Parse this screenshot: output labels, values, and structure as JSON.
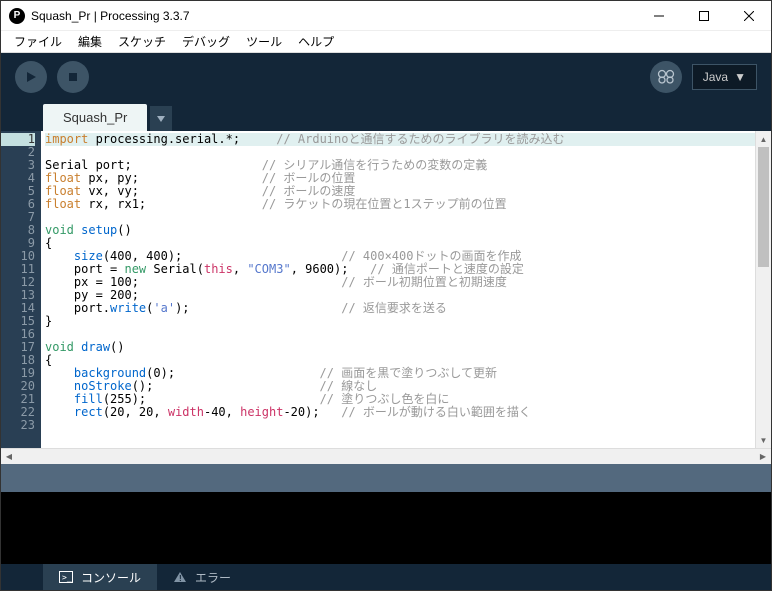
{
  "title": "Squash_Pr | Processing 3.3.7",
  "menu": [
    "ファイル",
    "編集",
    "スケッチ",
    "デバッグ",
    "ツール",
    "ヘルプ"
  ],
  "mode": "Java",
  "tab": "Squash_Pr",
  "bottom": {
    "console": "コンソール",
    "errors": "エラー"
  },
  "lines": [
    {
      "n": 1,
      "active": true,
      "hl": true,
      "seg": [
        [
          "kw-import",
          "import"
        ],
        [
          "blk",
          " processing.serial."
        ],
        [
          "blk",
          "*"
        ],
        [
          "blk",
          ";     "
        ],
        [
          "cmt",
          "// Arduinoと通信するためのライブラリを読み込む"
        ]
      ]
    },
    {
      "n": 2,
      "seg": []
    },
    {
      "n": 3,
      "seg": [
        [
          "blk",
          "Serial port;                  "
        ],
        [
          "cmt",
          "// シリアル通信を行うための変数の定義"
        ]
      ]
    },
    {
      "n": 4,
      "seg": [
        [
          "kw-type",
          "float"
        ],
        [
          "blk",
          " px, py;                 "
        ],
        [
          "cmt",
          "// ボールの位置"
        ]
      ]
    },
    {
      "n": 5,
      "seg": [
        [
          "kw-type",
          "float"
        ],
        [
          "blk",
          " vx, vy;                 "
        ],
        [
          "cmt",
          "// ボールの速度"
        ]
      ]
    },
    {
      "n": 6,
      "seg": [
        [
          "kw-type",
          "float"
        ],
        [
          "blk",
          " rx, rx1;                "
        ],
        [
          "cmt",
          "// ラケットの現在位置と1ステップ前の位置"
        ]
      ]
    },
    {
      "n": 7,
      "seg": []
    },
    {
      "n": 8,
      "seg": [
        [
          "kw-void",
          "void"
        ],
        [
          "blk",
          " "
        ],
        [
          "kw-setup",
          "setup"
        ],
        [
          "blk",
          "()"
        ]
      ]
    },
    {
      "n": 9,
      "seg": [
        [
          "blk",
          "{"
        ]
      ]
    },
    {
      "n": 10,
      "seg": [
        [
          "blk",
          "    "
        ],
        [
          "kw-fn",
          "size"
        ],
        [
          "blk",
          "(400, 400);                      "
        ],
        [
          "cmt",
          "// 400×400ドットの画面を作成"
        ]
      ]
    },
    {
      "n": 11,
      "seg": [
        [
          "blk",
          "    port = "
        ],
        [
          "kw-new",
          "new"
        ],
        [
          "blk",
          " Serial("
        ],
        [
          "kw-this",
          "this"
        ],
        [
          "blk",
          ", "
        ],
        [
          "str",
          "\"COM3\""
        ],
        [
          "blk",
          ", 9600);   "
        ],
        [
          "cmt",
          "// 通信ポートと速度の設定"
        ]
      ]
    },
    {
      "n": 12,
      "seg": [
        [
          "blk",
          "    px = 100;                            "
        ],
        [
          "cmt",
          "// ボール初期位置と初期速度"
        ]
      ]
    },
    {
      "n": 13,
      "seg": [
        [
          "blk",
          "    py = 200;"
        ]
      ]
    },
    {
      "n": 14,
      "seg": [
        [
          "blk",
          "    port."
        ],
        [
          "kw-fn",
          "write"
        ],
        [
          "blk",
          "("
        ],
        [
          "str",
          "'a'"
        ],
        [
          "blk",
          ");                     "
        ],
        [
          "cmt",
          "// 返信要求を送る"
        ]
      ]
    },
    {
      "n": 15,
      "seg": [
        [
          "blk",
          "}"
        ]
      ]
    },
    {
      "n": 16,
      "seg": []
    },
    {
      "n": 17,
      "seg": [
        [
          "kw-void",
          "void"
        ],
        [
          "blk",
          " "
        ],
        [
          "kw-draw",
          "draw"
        ],
        [
          "blk",
          "()"
        ]
      ]
    },
    {
      "n": 18,
      "seg": [
        [
          "blk",
          "{"
        ]
      ]
    },
    {
      "n": 19,
      "seg": [
        [
          "blk",
          "    "
        ],
        [
          "kw-fn",
          "background"
        ],
        [
          "blk",
          "(0);                    "
        ],
        [
          "cmt",
          "// 画面を黒で塗りつぶして更新"
        ]
      ]
    },
    {
      "n": 20,
      "seg": [
        [
          "blk",
          "    "
        ],
        [
          "kw-fn",
          "noStroke"
        ],
        [
          "blk",
          "();                       "
        ],
        [
          "cmt",
          "// 線なし"
        ]
      ]
    },
    {
      "n": 21,
      "seg": [
        [
          "blk",
          "    "
        ],
        [
          "kw-fn",
          "fill"
        ],
        [
          "blk",
          "(255);                        "
        ],
        [
          "cmt",
          "// 塗りつぶし色を白に"
        ]
      ]
    },
    {
      "n": 22,
      "seg": [
        [
          "blk",
          "    "
        ],
        [
          "kw-fn",
          "rect"
        ],
        [
          "blk",
          "(20, 20, "
        ],
        [
          "kw-const",
          "width"
        ],
        [
          "blk",
          "-40, "
        ],
        [
          "kw-const",
          "height"
        ],
        [
          "blk",
          "-20);   "
        ],
        [
          "cmt",
          "// ボールが動ける白い範囲を描く"
        ]
      ]
    },
    {
      "n": 23,
      "seg": []
    }
  ]
}
